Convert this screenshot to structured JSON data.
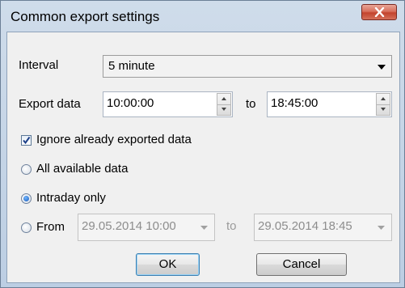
{
  "window": {
    "title": "Common export settings"
  },
  "interval": {
    "label": "Interval",
    "value": "5 minute"
  },
  "export_data": {
    "label": "Export data",
    "from_time": "10:00:00",
    "to_label": "to",
    "to_time": "18:45:00"
  },
  "ignore_exported": {
    "label": "Ignore already exported data",
    "checked": true
  },
  "range_options": {
    "all": {
      "label": "All available data",
      "selected": false
    },
    "intraday": {
      "label": "Intraday only",
      "selected": true
    },
    "from": {
      "label": "From",
      "selected": false
    }
  },
  "from_range": {
    "from_value": "29.05.2014 10:00",
    "to_label": "to",
    "to_value": "29.05.2014 18:45"
  },
  "buttons": {
    "ok": "OK",
    "cancel": "Cancel"
  },
  "icons": {
    "close": "close-icon",
    "dropdown": "chevron-down-icon",
    "spin_up": "arrow-up-icon",
    "spin_down": "arrow-down-icon",
    "check": "checkmark-icon"
  },
  "colors": {
    "title_bg": "#c4d5e8",
    "close_button": "#c7462f",
    "client_bg": "#f0f0f0"
  }
}
